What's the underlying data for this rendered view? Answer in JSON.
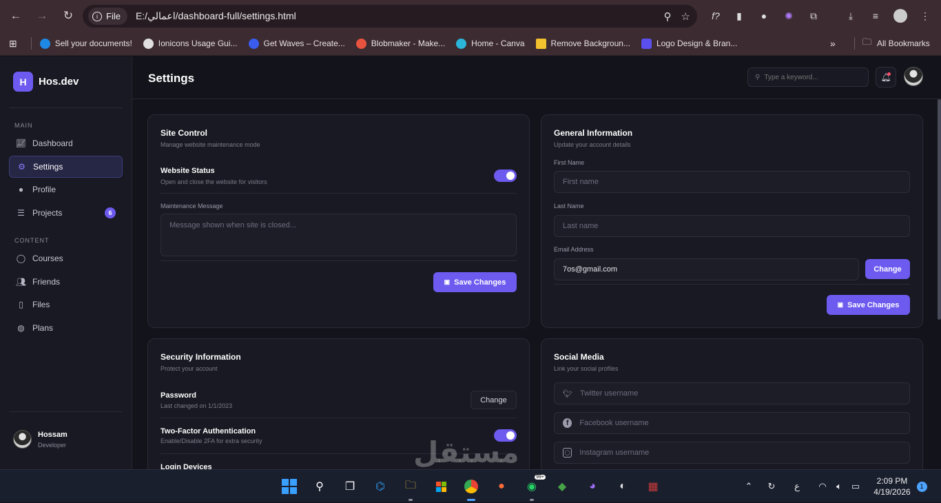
{
  "browser": {
    "info_label": "File",
    "url": "E:/اعمالي/dashboard-full/settings.html",
    "bookmarks": [
      {
        "label": "Sell your documents!",
        "color": "#1e88e5"
      },
      {
        "label": "Ionicons Usage Gui...",
        "color": "#e0e0e0"
      },
      {
        "label": "Get Waves – Create...",
        "color": "#3a5df0"
      },
      {
        "label": "Blobmaker - Make...",
        "color": "#e8533f"
      },
      {
        "label": "Home - Canva",
        "color": "#2bb6d9"
      },
      {
        "label": "Remove Backgroun...",
        "color": "#f2c12e"
      },
      {
        "label": "Logo Design & Bran...",
        "color": "#5b4ff0"
      }
    ],
    "all_bookmarks": "All Bookmarks"
  },
  "brand": {
    "logo_letter": "H",
    "name": "Hos.dev"
  },
  "sidebar": {
    "section_main": "MAIN",
    "section_content": "CONTENT",
    "items": [
      {
        "label": "Dashboard",
        "icon": "chart-line-icon"
      },
      {
        "label": "Settings",
        "icon": "gear-icon"
      },
      {
        "label": "Profile",
        "icon": "user-icon"
      },
      {
        "label": "Projects",
        "icon": "list-icon",
        "badge": "6"
      },
      {
        "label": "Courses",
        "icon": "chat-icon"
      },
      {
        "label": "Friends",
        "icon": "people-icon"
      },
      {
        "label": "Files",
        "icon": "file-icon"
      },
      {
        "label": "Plans",
        "icon": "globe-icon"
      }
    ],
    "user": {
      "name": "Hossam",
      "role": "Developer"
    }
  },
  "header": {
    "title": "Settings",
    "search_placeholder": "Type a keyword..."
  },
  "site_control": {
    "title": "Site Control",
    "subtitle": "Manage website maintenance mode",
    "status_title": "Website Status",
    "status_sub": "Open and close the website for visitors",
    "status_on": true,
    "maint_label": "Maintenance Message",
    "maint_placeholder": "Message shown when site is closed...",
    "save": "Save Changes"
  },
  "general": {
    "title": "General Information",
    "subtitle": "Update your account details",
    "first_label": "First Name",
    "first_placeholder": "First name",
    "last_label": "Last Name",
    "last_placeholder": "Last name",
    "email_label": "Email Address",
    "email_value": "7os@gmail.com",
    "change": "Change",
    "save": "Save Changes"
  },
  "security": {
    "title": "Security Information",
    "subtitle": "Protect your account",
    "password_title": "Password",
    "password_sub": "Last changed on 1/1/2023",
    "change": "Change",
    "tfa_title": "Two-Factor Authentication",
    "tfa_sub": "Enable/Disable 2FA for extra security",
    "tfa_on": true,
    "devices_title": "Login Devices"
  },
  "social": {
    "title": "Social Media",
    "subtitle": "Link your social profiles",
    "twitter_placeholder": "Twitter username",
    "facebook_placeholder": "Facebook username",
    "instagram_placeholder": "Instagram username"
  },
  "taskbar": {
    "time": "2:09 PM",
    "date": "4/19/2026",
    "lang": "ع",
    "notif_count": "1",
    "whatsapp_badge": "99+"
  },
  "watermark": "مستقل"
}
